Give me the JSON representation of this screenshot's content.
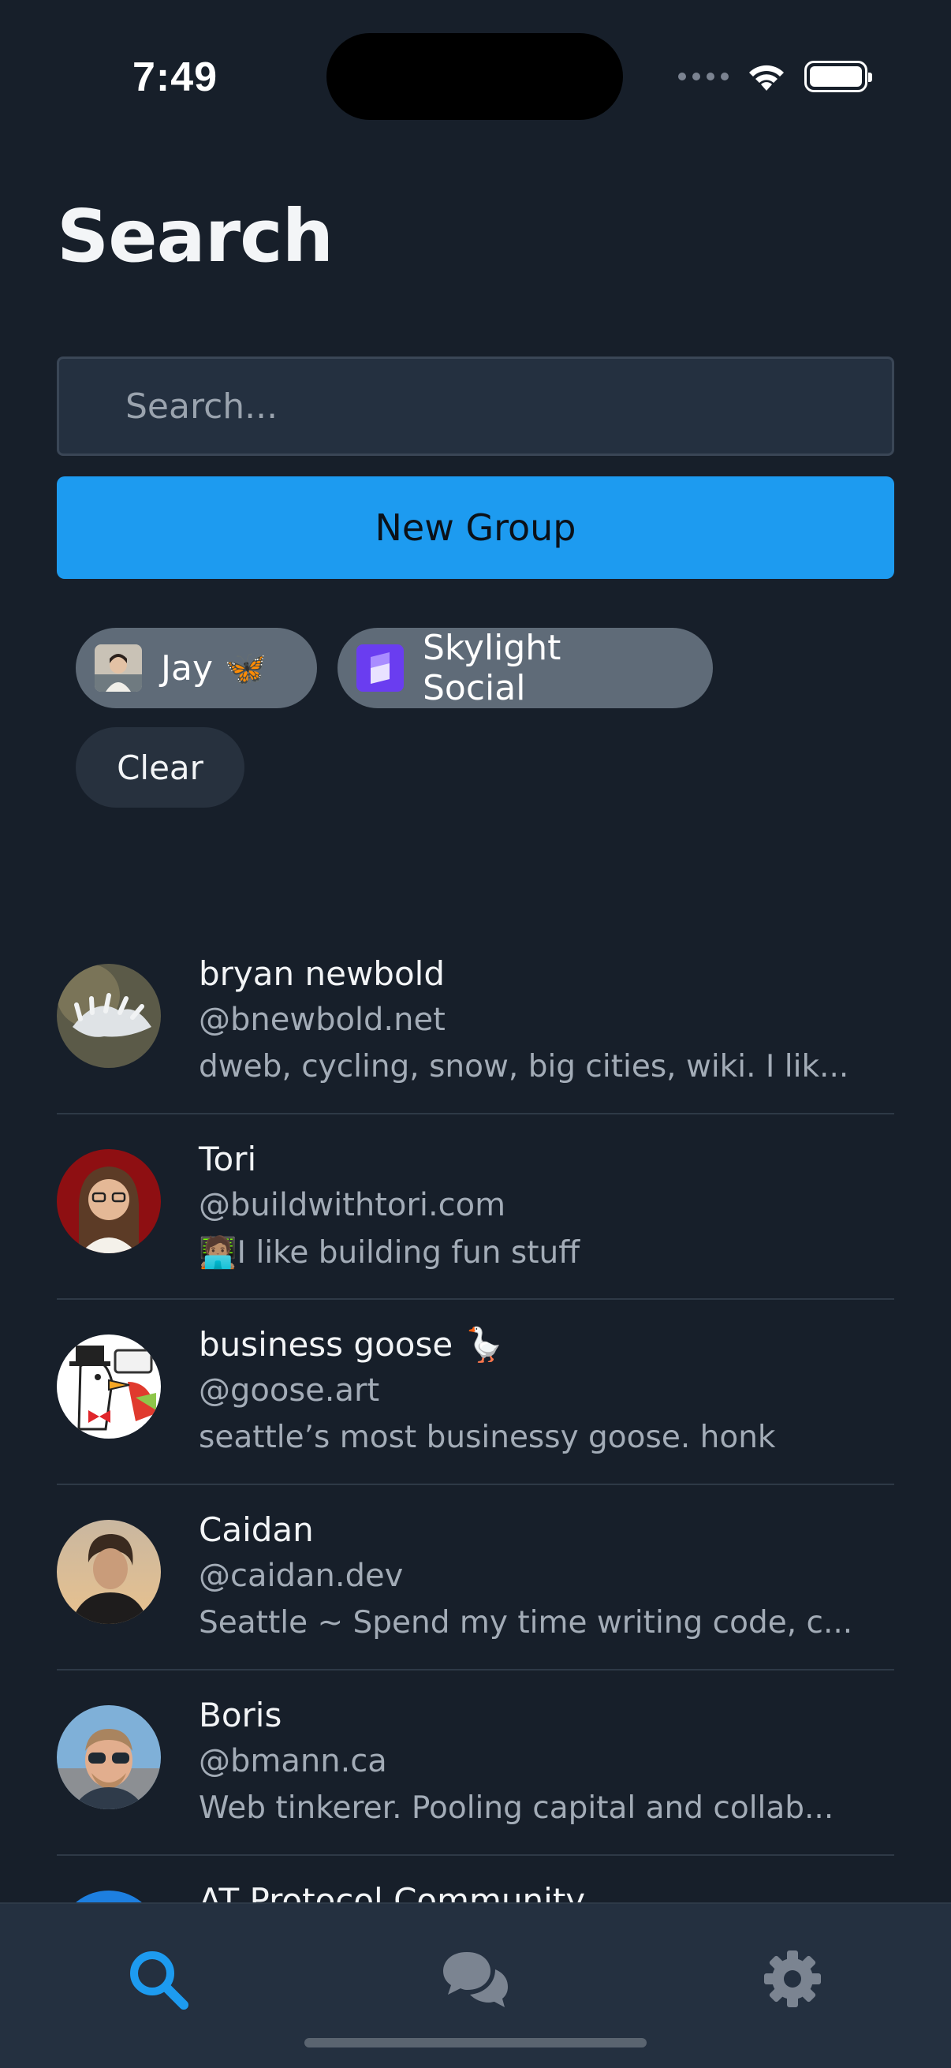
{
  "status_bar": {
    "time": "7:49"
  },
  "header": {
    "title": "Search"
  },
  "search": {
    "placeholder": "Search...",
    "value": ""
  },
  "new_group_button": {
    "label": "New Group"
  },
  "selected_chips": [
    {
      "label": "Jay 🦋"
    },
    {
      "label": "Skylight Social"
    }
  ],
  "clear_button": {
    "label": "Clear"
  },
  "results": [
    {
      "name": "bryan newbold",
      "handle": "@bnewbold.net",
      "bio": "dweb, cycling, snow, big cities, wiki. I lik..."
    },
    {
      "name": "Tori",
      "handle": "@buildwithtori.com",
      "bio": "🧑🏽‍💻I like building fun stuff"
    },
    {
      "name": "business goose 🪿",
      "handle": "@goose.art",
      "bio": "seattle’s most businessy goose. honk"
    },
    {
      "name": "Caidan",
      "handle": "@caidan.dev",
      "bio": "Seattle ~ Spend my time writing code, c..."
    },
    {
      "name": "Boris",
      "handle": "@bmann.ca",
      "bio": "Web tinkerer. Pooling capital and collab..."
    },
    {
      "name": "AT Protocol Community",
      "handle": "",
      "bio": ""
    }
  ],
  "tab_bar": {
    "tabs": [
      {
        "icon": "search-icon",
        "active": true
      },
      {
        "icon": "chat-bubbles-icon",
        "active": false
      },
      {
        "icon": "gear-icon",
        "active": false
      }
    ]
  },
  "colors": {
    "background": "#171f2a",
    "accent": "#1d9bf0",
    "chip": "#5f6b78",
    "tab_bar": "#243040"
  }
}
